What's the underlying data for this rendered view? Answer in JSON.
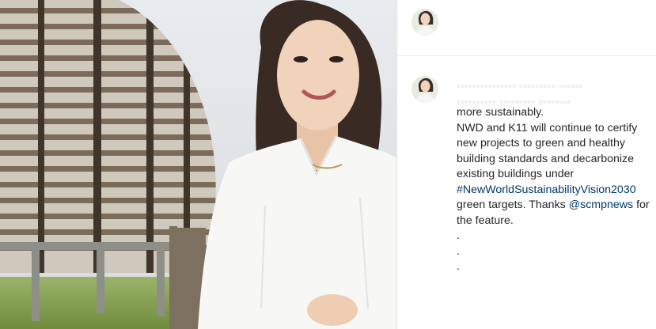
{
  "post": {
    "author_avatar": "avatar-photo",
    "caption": {
      "blurred_line_1": "··············· ········· ······",
      "blurred_line_2": "·········· ········· ········",
      "line_3": "more sustainably.",
      "line_4": "NWD and K11 will continue to certify",
      "line_5": "new projects to green and healthy",
      "line_6": "building standards and decarbonize",
      "line_7": "existing buildings under",
      "hashtag": "#NewWorldSustainabilityVision2030",
      "line_9_text": "green targets. Thanks ",
      "mention": "@scmpnews",
      "line_9_after": " for",
      "line_10": "the feature.",
      "dots": [
        ".",
        ".",
        "."
      ]
    }
  },
  "colors": {
    "link": "#00376b",
    "text": "#262626"
  }
}
